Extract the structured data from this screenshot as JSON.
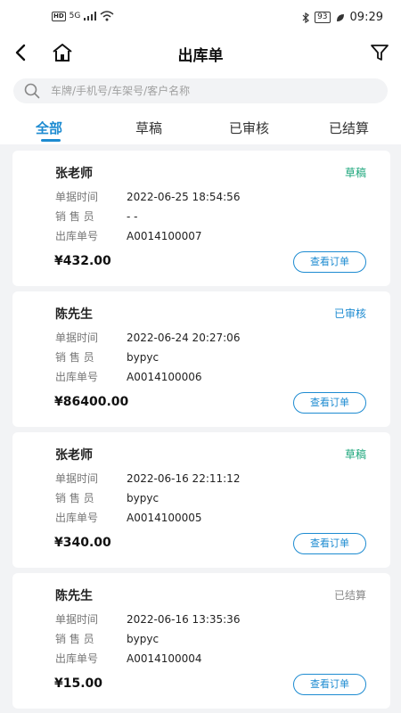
{
  "status_bar": {
    "left_badge": "HD",
    "network": "5G",
    "battery": "93",
    "time": "09:29"
  },
  "header": {
    "title": "出库单",
    "back_icon": "back-arrow-icon",
    "home_icon": "home-icon",
    "filter_icon": "filter-icon"
  },
  "search": {
    "placeholder": "车牌/手机号/车架号/客户名称"
  },
  "tabs": [
    {
      "label": "全部",
      "active": true
    },
    {
      "label": "草稿",
      "active": false
    },
    {
      "label": "已审核",
      "active": false
    },
    {
      "label": "已结算",
      "active": false
    }
  ],
  "labels": {
    "time": "单据时间",
    "seller": "销 售 员",
    "order_no": "出库单号",
    "view_button": "查看订单"
  },
  "colors": {
    "accent": "#1d8bd1",
    "draft": "#1aa57a",
    "audited": "#1d8bd1",
    "settled": "#888888"
  },
  "orders": [
    {
      "customer": "张老师",
      "status": "草稿",
      "time": "2022-06-25 18:54:56",
      "seller": "- -",
      "order_no": "A0014100007",
      "amount": "¥432.00"
    },
    {
      "customer": "陈先生",
      "status": "已审核",
      "time": "2022-06-24 20:27:06",
      "seller": "bypyc",
      "order_no": "A0014100006",
      "amount": "¥86400.00"
    },
    {
      "customer": "张老师",
      "status": "草稿",
      "time": "2022-06-16 22:11:12",
      "seller": "bypyc",
      "order_no": "A0014100005",
      "amount": "¥340.00"
    },
    {
      "customer": "陈先生",
      "status": "已结算",
      "time": "2022-06-16 13:35:36",
      "seller": "bypyc",
      "order_no": "A0014100004",
      "amount": "¥15.00"
    }
  ]
}
